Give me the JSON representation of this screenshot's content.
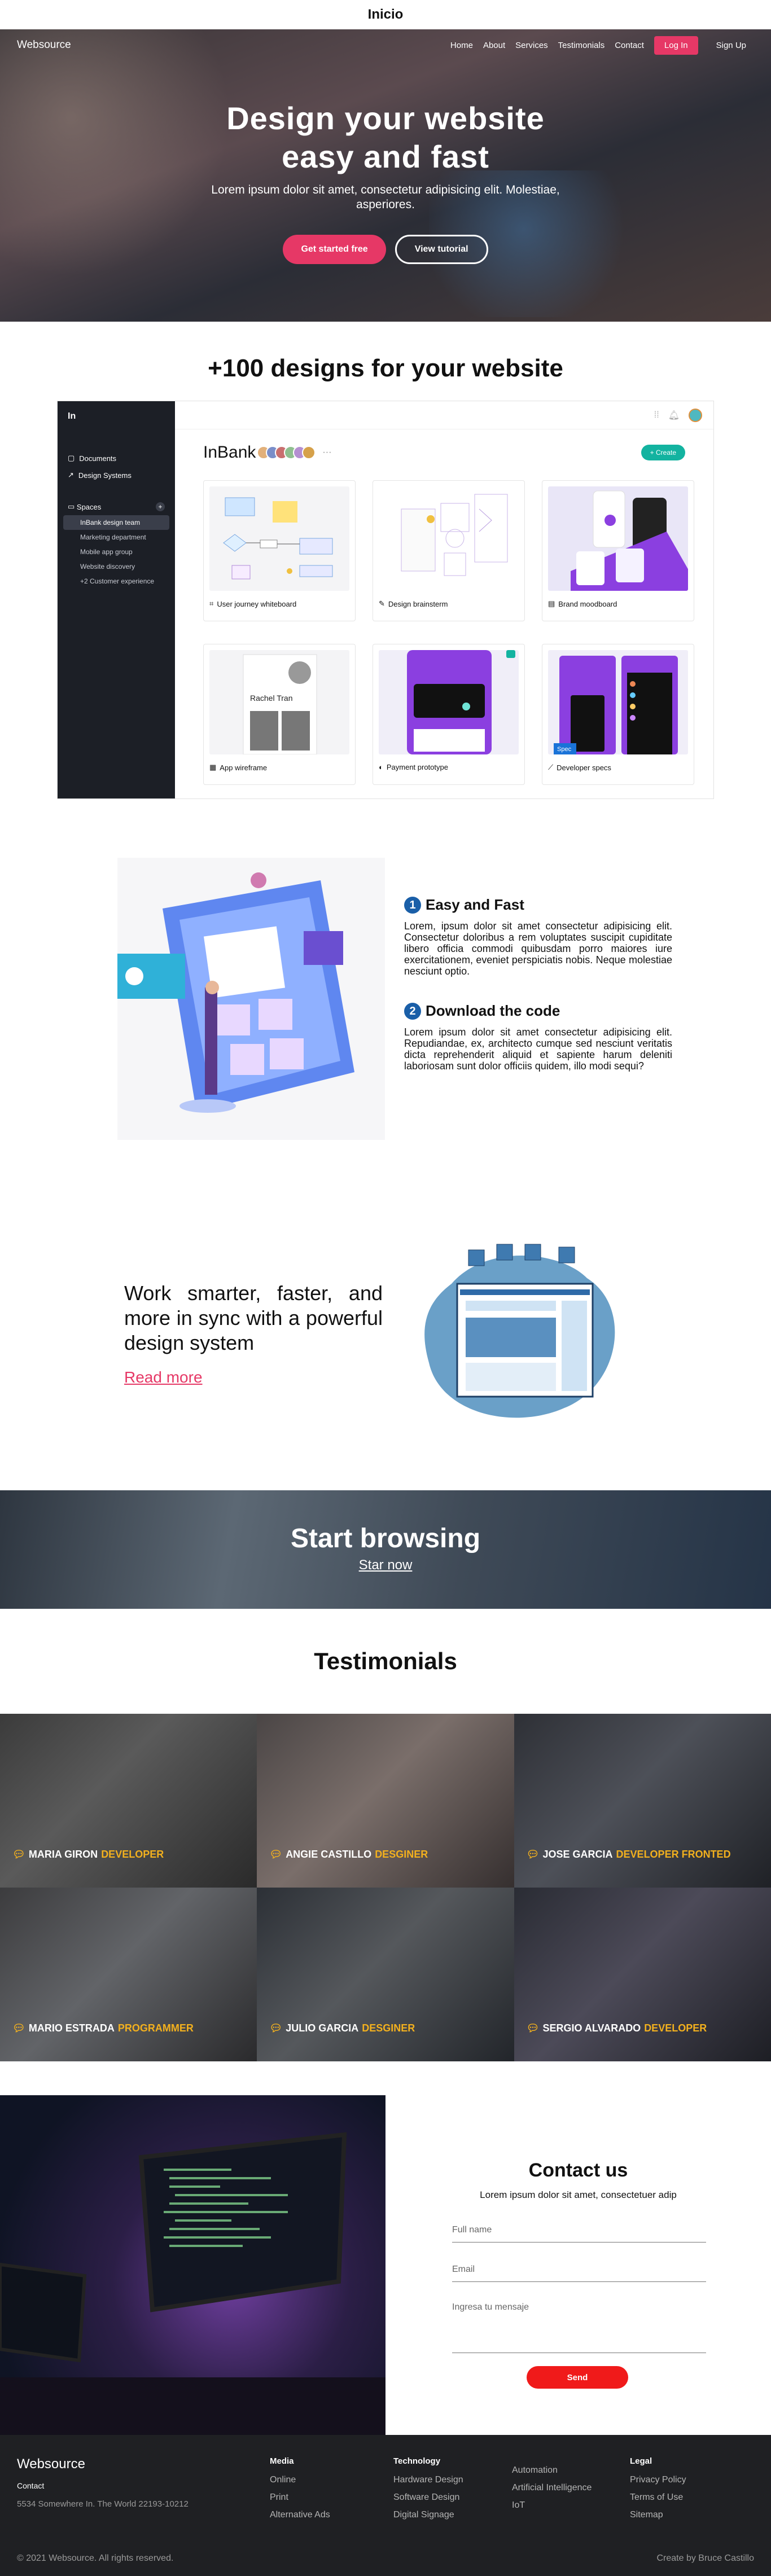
{
  "page_title": "Inicio",
  "nav": {
    "brand": "Websource",
    "links": [
      "Home",
      "About",
      "Services",
      "Testimonials",
      "Contact"
    ],
    "login": "Log In",
    "signup": "Sign Up"
  },
  "hero": {
    "title_line1": "Design your website",
    "title_line2": "easy and fast",
    "subtitle": "Lorem ipsum dolor sit amet, consectetur adipisicing elit. Molestiae, asperiores.",
    "cta_primary": "Get started free",
    "cta_secondary": "View tutorial"
  },
  "designs": {
    "title": "+100 designs for your website"
  },
  "app": {
    "logo": "In",
    "menu": [
      "Documents",
      "Design Systems"
    ],
    "spaces_label": "Spaces",
    "spaces": [
      "InBank design team",
      "Marketing department",
      "Mobile app group",
      "Website discovery",
      "+2 Customer experience"
    ],
    "workspace": "InBank",
    "create": "+ Create",
    "cards": [
      "User journey whiteboard",
      "Design brainsterm",
      "Brand moodboard",
      "App wireframe",
      "Payment prototype",
      "Developer specs"
    ],
    "card_person": "Rachel Tran",
    "card_label_spec": "Spec"
  },
  "features": [
    {
      "num": "1",
      "title": "Easy and Fast",
      "text": "Lorem, ipsum dolor sit amet consectetur adipisicing elit. Consectetur doloribus a rem voluptates suscipit cupiditate libero officia commodi quibusdam porro maiores iure exercitationem, eveniet perspiciatis nobis. Neque molestiae nesciunt optio."
    },
    {
      "num": "2",
      "title": "Download the code",
      "text": "Lorem ipsum dolor sit amet consectetur adipisicing elit. Repudiandae, ex, architecto cumque sed nesciunt veritatis dicta reprehenderit aliquid et sapiente harum deleniti laboriosam sunt dolor officiis quidem, illo modi sequi?"
    }
  ],
  "work": {
    "text": "Work smarter, faster, and more in sync with a powerful design system",
    "link": "Read more"
  },
  "browse": {
    "title": "Start browsing",
    "link": "Star now"
  },
  "testimonials": {
    "title": "Testimonials",
    "people": [
      {
        "name": "MARIA GIRON",
        "role": "DEVELOPER"
      },
      {
        "name": "ANGIE CASTILLO",
        "role": "DESGINER"
      },
      {
        "name": "JOSE GARCIA",
        "role": "DEVELOPER FRONTED"
      },
      {
        "name": "MARIO ESTRADA",
        "role": "PROGRAMMER"
      },
      {
        "name": "JULIO GARCIA",
        "role": "DESGINER"
      },
      {
        "name": "SERGIO ALVARADO",
        "role": "DEVELOPER"
      }
    ]
  },
  "contact": {
    "title": "Contact us",
    "subtitle": "Lorem ipsum dolor sit amet, consectetuer adip",
    "name_ph": "Full name",
    "email_ph": "Email",
    "msg_ph": "Ingresa tu mensaje",
    "send": "Send"
  },
  "footer": {
    "brand": "Websource",
    "contact_label": "Contact",
    "address": "5534 Somewhere In. The World 22193-10212",
    "cols": [
      {
        "title": "Media",
        "links": [
          "Online",
          "Print",
          "Alternative Ads"
        ]
      },
      {
        "title": "Technology",
        "links": [
          "Hardware Design",
          "Software Design",
          "Digital Signage"
        ]
      },
      {
        "title": "",
        "links": [
          "Automation",
          "Artificial Intelligence",
          "IoT"
        ]
      },
      {
        "title": "Legal",
        "links": [
          "Privacy Policy",
          "Terms of Use",
          "Sitemap"
        ]
      }
    ],
    "copyright": "© 2021 Websource. All rights reserved.",
    "credit": "Create by Bruce Castillo"
  },
  "colors": {
    "accent": "#e63866",
    "brand_blue": "#1a5fa8",
    "teal": "#13b3a0",
    "role_yellow": "#f2b01e",
    "send_red": "#f01a1a"
  }
}
